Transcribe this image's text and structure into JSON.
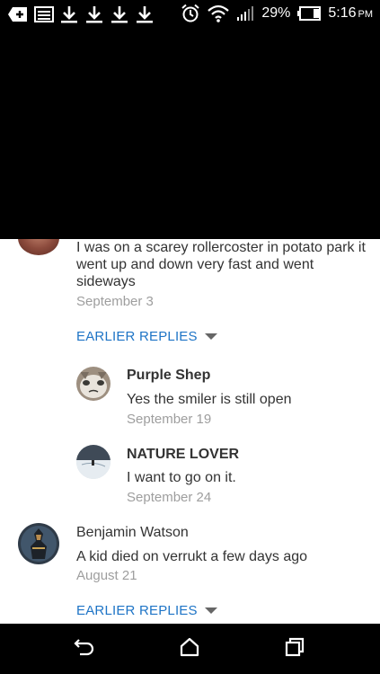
{
  "status_bar": {
    "battery_percent": "29%",
    "time": "5:16",
    "ampm": "PM",
    "icons": [
      "add-box-icon",
      "image-icon",
      "download-icon",
      "download-icon",
      "download-icon",
      "download-icon",
      "alarm-icon",
      "wifi-icon",
      "signal-icon",
      "battery-icon"
    ]
  },
  "comments": [
    {
      "text": "I was on a scarey rollercoster in potato park it went up and down very fast and went sideways",
      "date": "September 3",
      "earlier_replies_label": "EARLIER REPLIES",
      "replies": [
        {
          "name": "Purple Shep",
          "text": "Yes the smiler is still open",
          "date": "September 19"
        },
        {
          "name": "NATURE LOVER",
          "text": "I want to go on it.",
          "date": "September 24"
        }
      ]
    },
    {
      "name": "Benjamin Watson",
      "text": "A kid died on verrukt a few days ago",
      "date": "August 21",
      "earlier_replies_label": "EARLIER REPLIES"
    }
  ],
  "nav_bar": {
    "icons": [
      "back-icon",
      "home-icon",
      "recents-icon"
    ]
  }
}
